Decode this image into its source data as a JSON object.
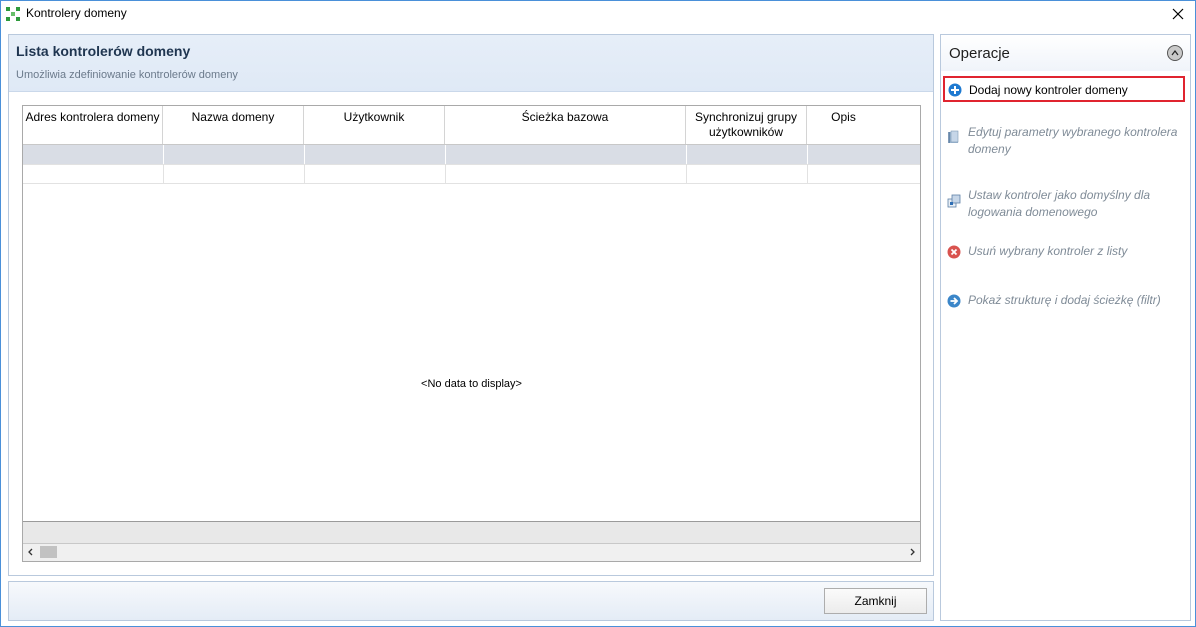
{
  "window": {
    "title": "Kontrolery domeny",
    "close_icon": "close-icon"
  },
  "main": {
    "title": "Lista kontrolerów domeny",
    "subtitle": "Umożliwia zdefiniowanie kontrolerów domeny"
  },
  "grid": {
    "columns": [
      "Adres kontrolera domeny",
      "Nazwa domeny",
      "Użytkownik",
      "Ścieżka bazowa",
      "Synchronizuj grupy użytkowników",
      "Opis"
    ],
    "empty_text": "<No data to display>"
  },
  "bottom": {
    "close_label": "Zamknij"
  },
  "operations": {
    "title": "Operacje",
    "items": [
      {
        "label": "Dodaj nowy kontroler domeny",
        "icon": "add-circle-icon",
        "enabled": true
      },
      {
        "label": "Edytuj parametry wybranego kontrolera domeny",
        "icon": "edit-book-icon",
        "enabled": false
      },
      {
        "label": "Ustaw kontroler jako domyślny dla logowania domenowego",
        "icon": "set-default-icon",
        "enabled": false
      },
      {
        "label": "Usuń wybrany kontroler z listy",
        "icon": "delete-circle-icon",
        "enabled": false
      },
      {
        "label": "Pokaż strukturę i dodaj ścieżkę (filtr)",
        "icon": "arrow-circle-icon",
        "enabled": false
      }
    ]
  },
  "colors": {
    "accent_border": "#e0242f",
    "header_bg": "#dfe9f6",
    "selected_row": "#d9dde5"
  }
}
